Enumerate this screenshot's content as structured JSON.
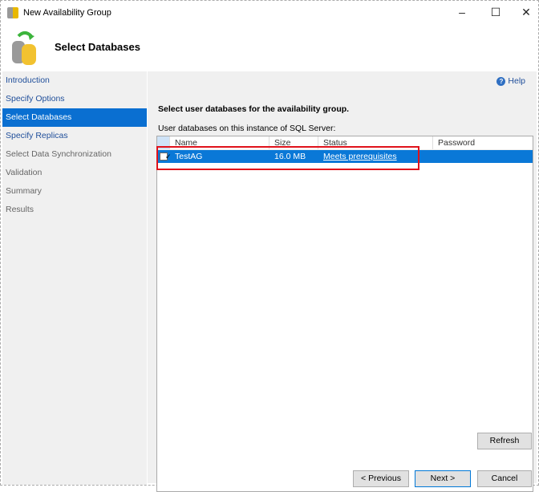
{
  "window": {
    "title": "New Availability Group",
    "minimize": "–",
    "maximize": "☐",
    "close": "✕"
  },
  "header": {
    "title": "Select Databases"
  },
  "sidebar": {
    "items": [
      {
        "label": "Introduction",
        "state": "link"
      },
      {
        "label": "Specify Options",
        "state": "link"
      },
      {
        "label": "Select Databases",
        "state": "active"
      },
      {
        "label": "Specify Replicas",
        "state": "link"
      },
      {
        "label": "Select Data Synchronization",
        "state": "disabled"
      },
      {
        "label": "Validation",
        "state": "disabled"
      },
      {
        "label": "Summary",
        "state": "disabled"
      },
      {
        "label": "Results",
        "state": "disabled"
      }
    ]
  },
  "main": {
    "help": "Help",
    "lead": "Select user databases for the availability group.",
    "sub": "User databases on this instance of SQL Server:",
    "columns": [
      "Name",
      "Size",
      "Status",
      "Password"
    ],
    "rows": [
      {
        "checked": true,
        "check": "✓",
        "name": "TestAG",
        "size": "16.0 MB",
        "status": "Meets prerequisites",
        "password": ""
      }
    ]
  },
  "buttons": {
    "refresh": "Refresh",
    "previous": "< Previous",
    "next": "Next >",
    "cancel": "Cancel"
  }
}
